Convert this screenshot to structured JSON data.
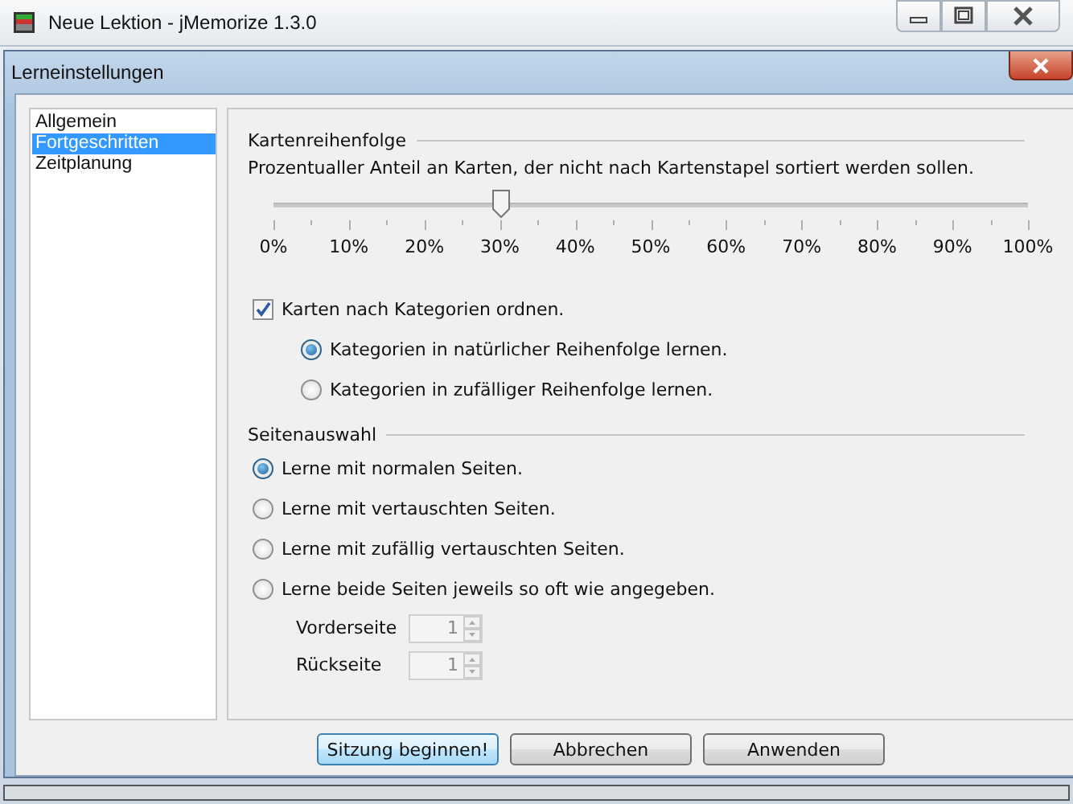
{
  "window": {
    "title": "Neue Lektion - jMemorize 1.3.0"
  },
  "dialog": {
    "title": "Lerneinstellungen"
  },
  "sidebar": {
    "items": [
      {
        "label": "Allgemein",
        "selected": false
      },
      {
        "label": "Fortgeschritten",
        "selected": true
      },
      {
        "label": "Zeitplanung",
        "selected": false
      }
    ]
  },
  "sections": [
    {
      "title": "Kartenreihenfolge",
      "items": [
        {
          "kind": "text",
          "label": "Prozentualler Anteil an Karten, der nicht nach Kartenstapel sortiert werden sollen."
        },
        {
          "kind": "slider",
          "level": 0.3,
          "tick_labels": [
            "0%",
            "10%",
            "20%",
            "30%",
            "40%",
            "50%",
            "60%",
            "70%",
            "80%",
            "90%",
            "100%"
          ]
        },
        {
          "kind": "checkbox",
          "label": "Karten nach Kategorien ordnen.",
          "checked": true,
          "children": [
            {
              "kind": "radio",
              "label": "Kategorien in natürlicher Reihenfolge lernen.",
              "selected": true
            },
            {
              "kind": "radio",
              "label": "Kategorien in zufälliger Reihenfolge lernen.",
              "selected": false
            }
          ]
        }
      ]
    },
    {
      "title": "Seitenauswahl",
      "items": [
        {
          "kind": "radio",
          "label": "Lerne mit normalen Seiten.",
          "selected": true
        },
        {
          "kind": "radio",
          "label": "Lerne mit vertauschten Seiten.",
          "selected": false
        },
        {
          "kind": "radio",
          "label": "Lerne mit zufällig vertauschten Seiten.",
          "selected": false
        },
        {
          "kind": "radio",
          "label": "Lerne beide Seiten jeweils so oft wie angegeben.",
          "selected": false,
          "children": [
            {
              "kind": "spinner",
              "label": "Vorderseite",
              "value": "1",
              "disabled": true
            },
            {
              "kind": "spinner",
              "label": "Rückseite",
              "value": "1",
              "disabled": true
            }
          ]
        }
      ]
    }
  ],
  "buttons": [
    {
      "label": "Sitzung beginnen!",
      "default": true
    },
    {
      "label": "Abbrechen",
      "default": false
    },
    {
      "label": "Anwenden",
      "default": false
    }
  ]
}
